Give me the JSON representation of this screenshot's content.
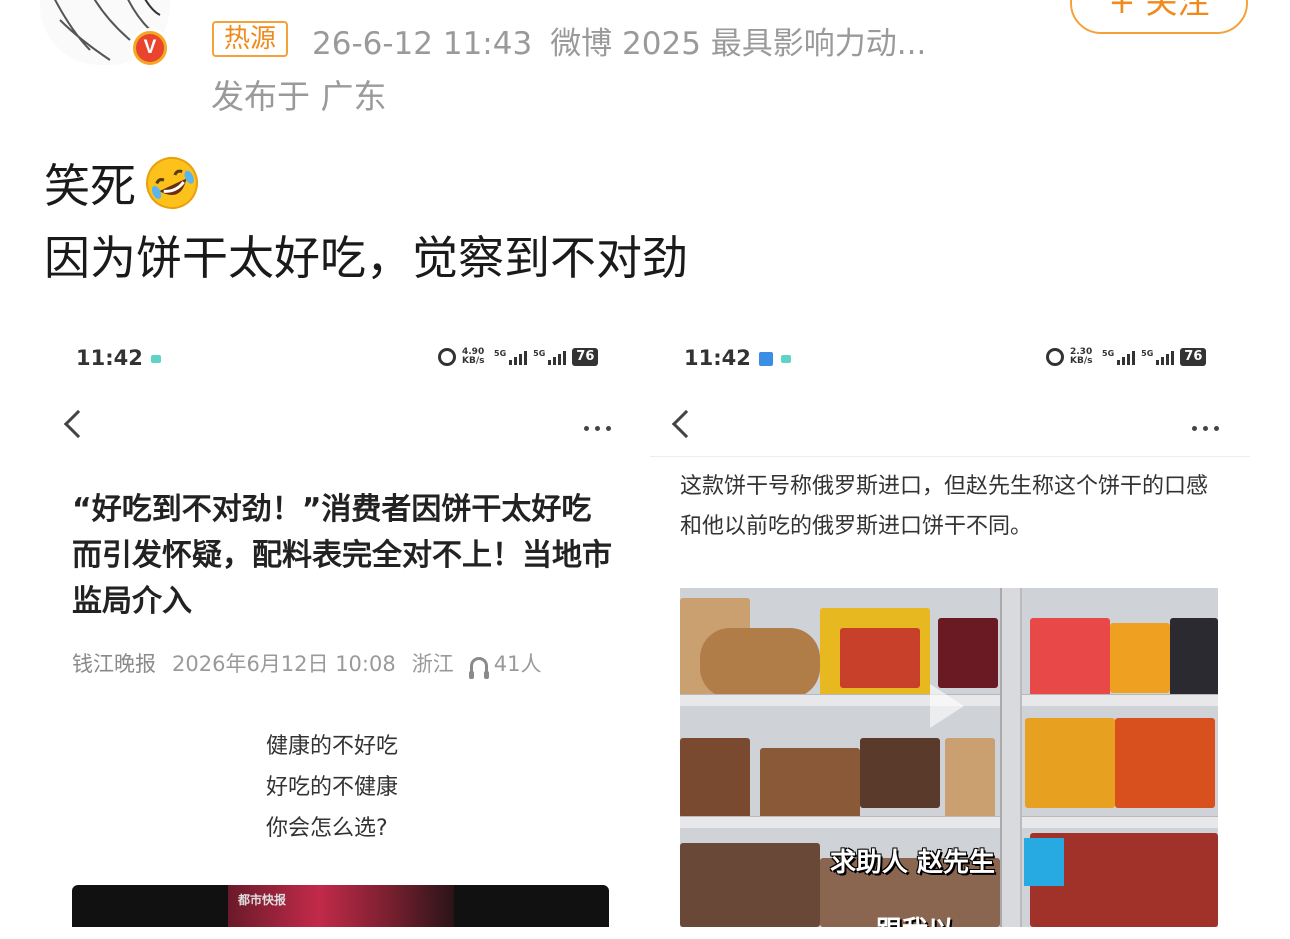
{
  "header": {
    "source_tag": "热源",
    "timestamp": "26-6-12 11:43",
    "award": "微博 2025 最具影响力动...",
    "location": "发布于 广东",
    "follow_label": "+ 关注",
    "verified_badge": "V"
  },
  "post": {
    "line1": "笑死",
    "line1_emoji": "rolling-on-floor-laughing",
    "line2": "因为饼干太好吃，觉察到不对劲"
  },
  "screenshot1": {
    "status_time": "11:42",
    "status_speed": "4.90 KB/s",
    "signal_label": "5G",
    "battery": "76",
    "article_title": "“好吃到不对劲！”消费者因饼干太好吃而引发怀疑，配料表完全对不上！当地市监局介入",
    "source": "钱江晚报",
    "date": "2026年6月12日 10:08",
    "region": "浙江",
    "listeners": "41人",
    "poem": [
      "健康的不好吃",
      "好吃的不健康",
      "你会怎么选?"
    ],
    "video_tag": "都市快报"
  },
  "screenshot2": {
    "status_time": "11:42",
    "status_speed": "2.30 KB/s",
    "signal_label": "5G",
    "battery": "76",
    "description": "这款饼干号称俄罗斯进口，但赵先生称这个饼干的口感和他以前吃的俄罗斯进口饼干不同。",
    "caption": "求助人 赵先生",
    "caption2": "跟我以"
  },
  "colors": {
    "accent_orange": "#f08a1c",
    "meta_gray": "#9a9a9a",
    "badge_red": "#e8442e"
  }
}
